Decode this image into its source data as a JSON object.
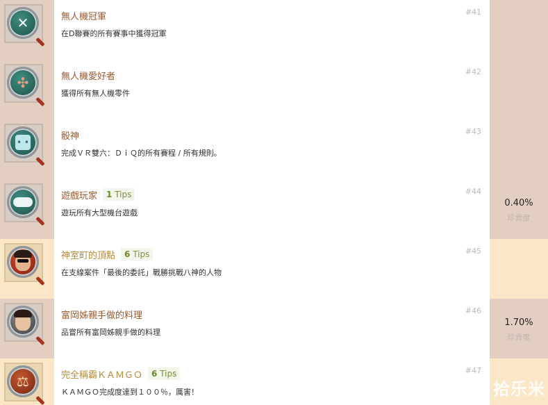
{
  "achievements": [
    {
      "title": "無人機冠軍",
      "tips_count": "",
      "tips_word": "",
      "desc": "在D聯賽的所有賽事中獲得冠軍",
      "num": "#41",
      "rate": "",
      "rate_label": "",
      "tier": "silver",
      "icon": "drone-expand-icon"
    },
    {
      "title": "無人機愛好者",
      "tips_count": "",
      "tips_word": "",
      "desc": "獲得所有無人機零件",
      "num": "#42",
      "rate": "",
      "rate_label": "",
      "tier": "silver",
      "icon": "drone-icon"
    },
    {
      "title": "骰神",
      "tips_count": "",
      "tips_word": "",
      "desc": "完成ＶＲ雙六：ＤｉＱ的所有賽程 / 所有規則。",
      "num": "#43",
      "rate": "",
      "rate_label": "",
      "tier": "silver",
      "icon": "dice-icon"
    },
    {
      "title": "遊戲玩家",
      "tips_count": "1",
      "tips_word": "Tips",
      "desc": "遊玩所有大型機台遊戲",
      "num": "#44",
      "rate": "0.40%",
      "rate_label": "珍貴度",
      "tier": "silver",
      "icon": "gamepad-icon"
    },
    {
      "title": "神室町的頂點",
      "tips_count": "6",
      "tips_word": "Tips",
      "desc": "在支線案件「最後的委託」戰勝挑戰八神的人物",
      "num": "#45",
      "rate": "",
      "rate_label": "",
      "tier": "gold",
      "icon": "man-sunglasses-portrait-icon"
    },
    {
      "title": "富岡姊親手做的料理",
      "tips_count": "",
      "tips_word": "",
      "desc": "品嘗所有富岡姊親手做的料理",
      "num": "#46",
      "rate": "1.70%",
      "rate_label": "珍貴度",
      "tier": "silver",
      "icon": "woman-portrait-icon"
    },
    {
      "title": "完全稱霸ＫＡＭＧＯ",
      "tips_count": "6",
      "tips_word": "Tips",
      "desc": "ＫＡＭＧＯ完成度達到１００％，厲害！",
      "num": "#47",
      "rate": "",
      "rate_label": "",
      "tier": "gold",
      "icon": "scales-icon"
    }
  ],
  "watermark": "拾乐米"
}
